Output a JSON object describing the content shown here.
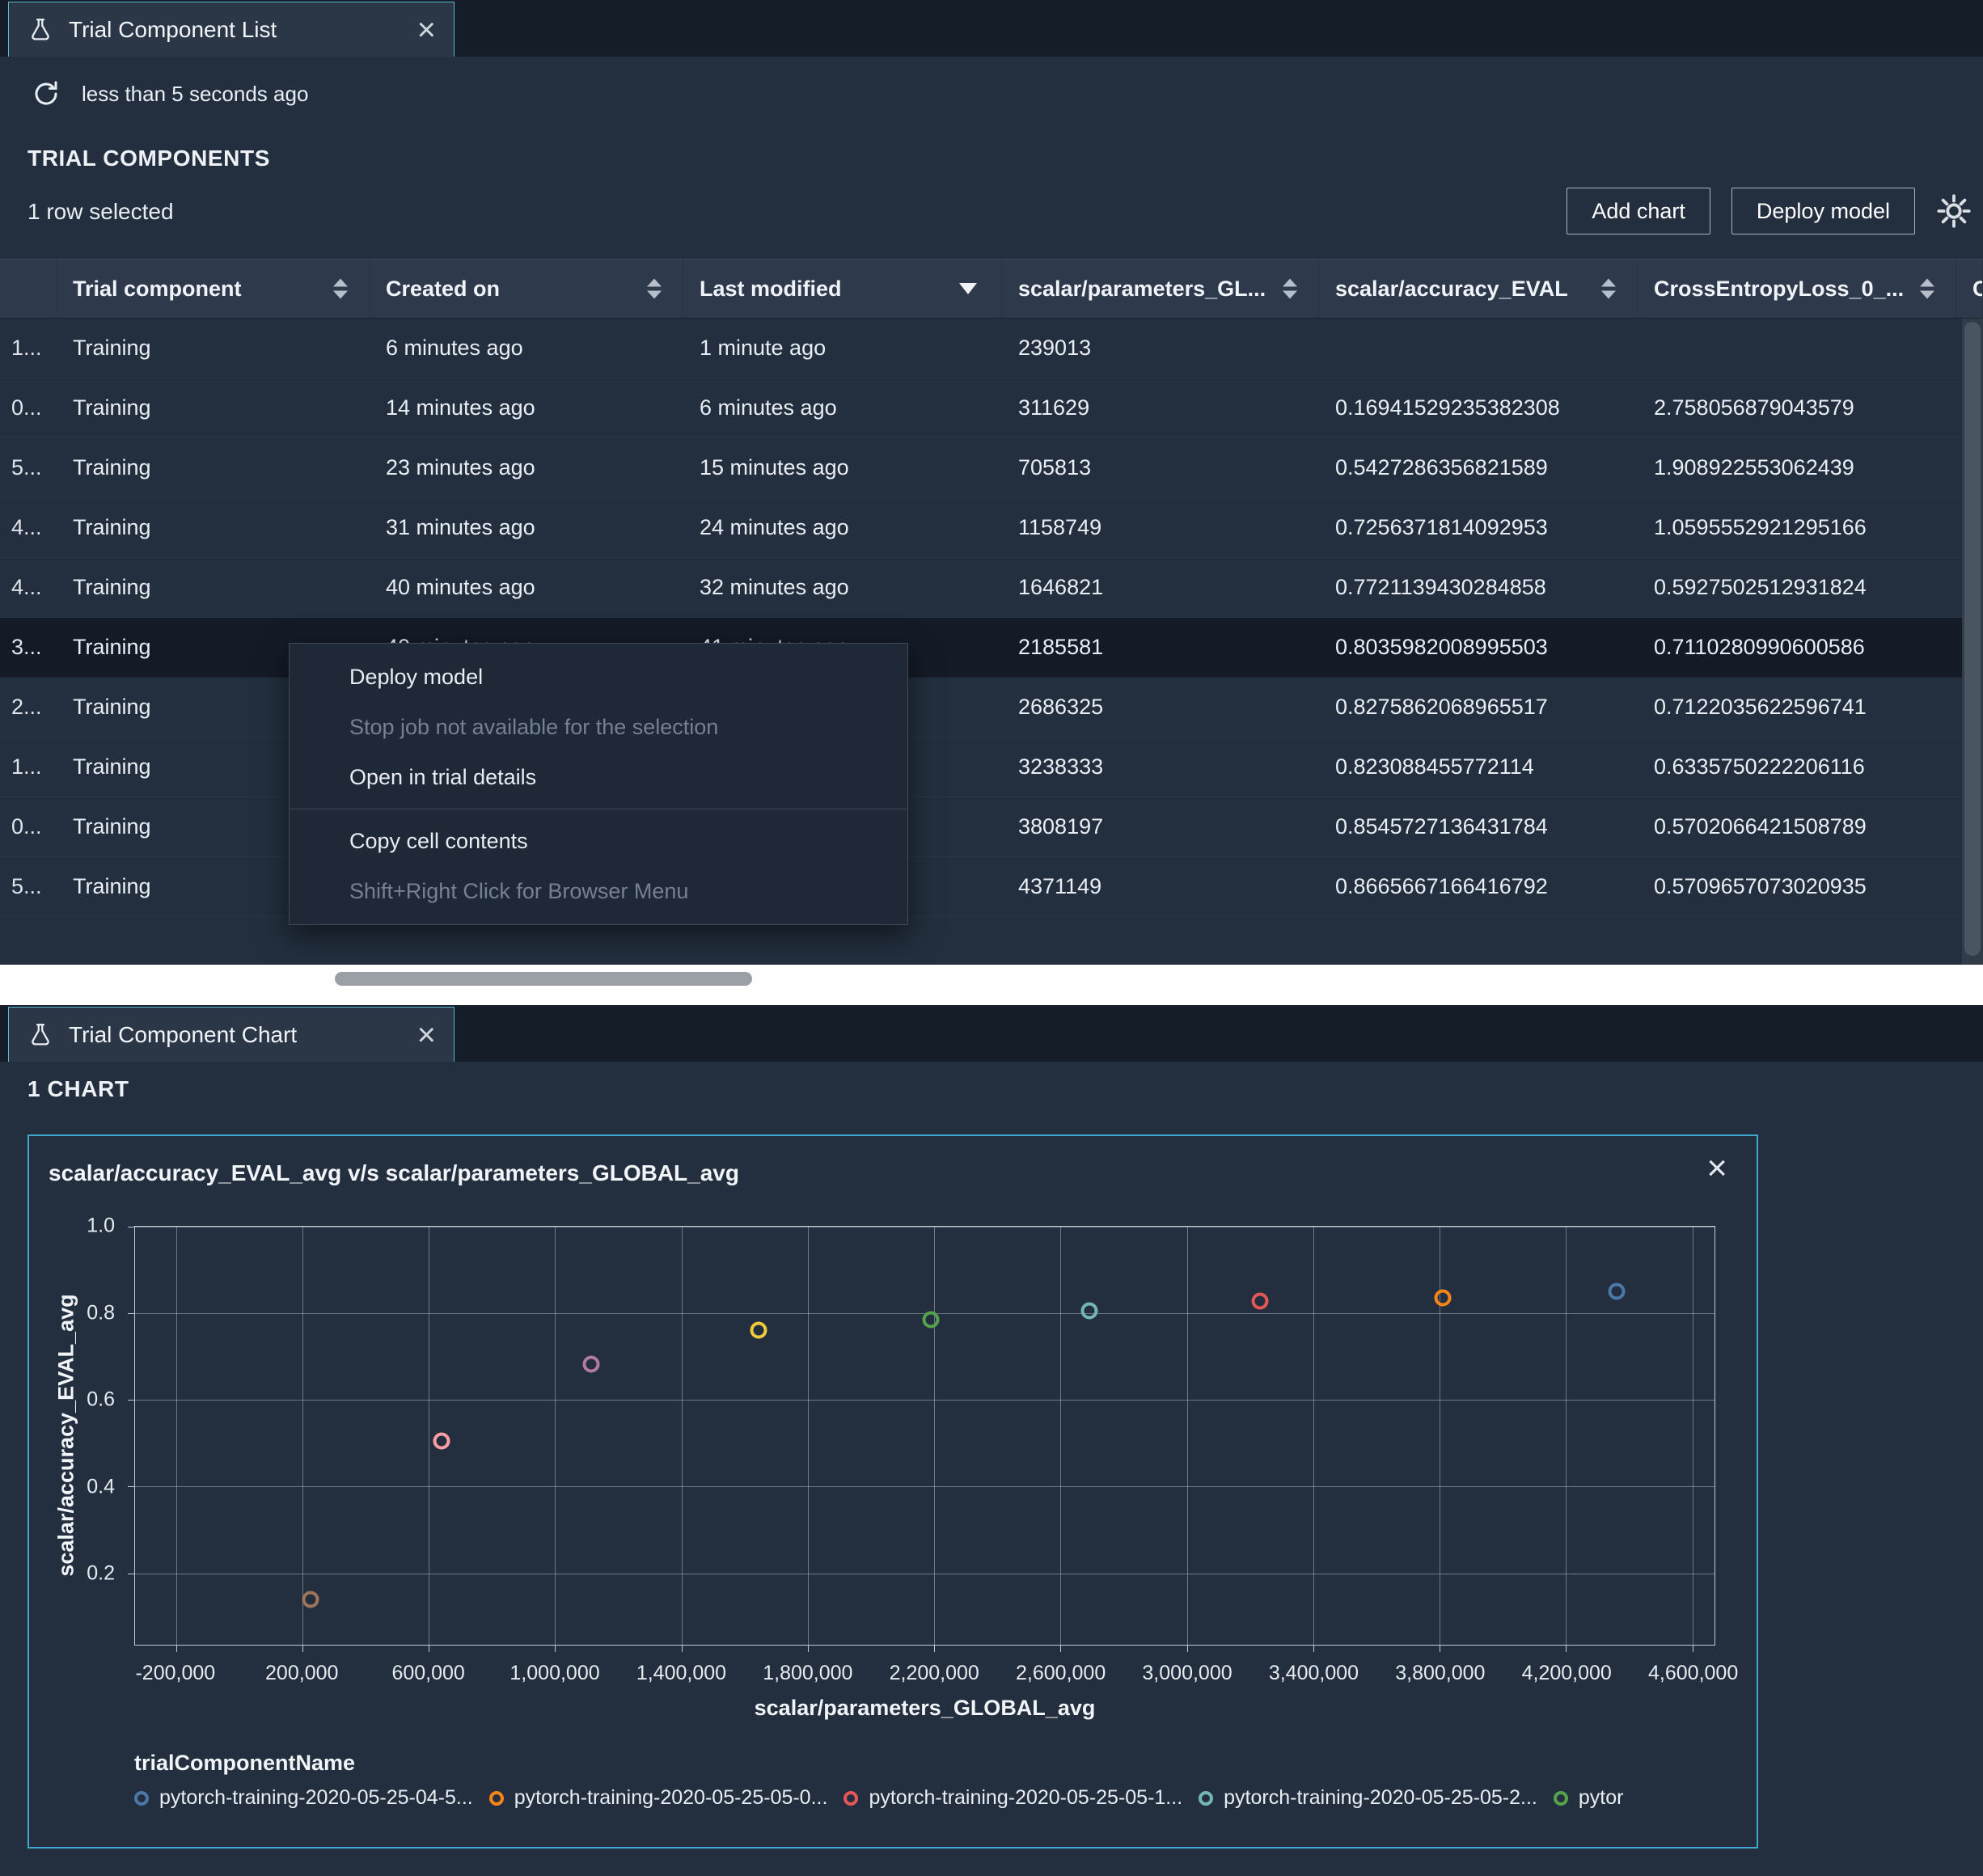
{
  "colors": {
    "panel_bg": "#232f3e",
    "tab_accent": "#58b7d2",
    "chart_border": "#3fa9cf",
    "selected_row_bg": "#141b27"
  },
  "icons": {
    "close": "×",
    "flask": "beaker-flask",
    "refresh": "circular-arrow",
    "gear": "gear",
    "sort": "up-down-arrows",
    "sort_desc": "filled-down-arrow"
  },
  "list_panel": {
    "tab_title": "Trial Component List",
    "refreshed": "less than 5 seconds ago",
    "section_title": "TRIAL COMPONENTS",
    "selection_status": "1 row selected",
    "buttons": {
      "add_chart": "Add chart",
      "deploy_model": "Deploy model"
    },
    "table": {
      "columns": [
        {
          "key": "name",
          "label": "",
          "sort": "none"
        },
        {
          "key": "trial-component",
          "label": "Trial component",
          "sort": "both"
        },
        {
          "key": "created-on",
          "label": "Created on",
          "sort": "both"
        },
        {
          "key": "last-modified",
          "label": "Last modified",
          "sort": "desc"
        },
        {
          "key": "parameters",
          "label": "scalar/parameters_GL...",
          "sort": "both"
        },
        {
          "key": "accuracy",
          "label": "scalar/accuracy_EVAL",
          "sort": "both"
        },
        {
          "key": "loss",
          "label": "CrossEntropyLoss_0_...",
          "sort": "both"
        },
        {
          "key": "extra",
          "label": "C",
          "sort": "none"
        }
      ],
      "rows": [
        {
          "name_trunc": "1...",
          "component": "Training",
          "created": "6 minutes ago",
          "modified": "1 minute ago",
          "parameters": "239013",
          "accuracy": "",
          "loss": ""
        },
        {
          "name_trunc": "0...",
          "component": "Training",
          "created": "14 minutes ago",
          "modified": "6 minutes ago",
          "parameters": "311629",
          "accuracy": "0.16941529235382308",
          "loss": "2.758056879043579"
        },
        {
          "name_trunc": "5...",
          "component": "Training",
          "created": "23 minutes ago",
          "modified": "15 minutes ago",
          "parameters": "705813",
          "accuracy": "0.5427286356821589",
          "loss": "1.908922553062439"
        },
        {
          "name_trunc": "4...",
          "component": "Training",
          "created": "31 minutes ago",
          "modified": "24 minutes ago",
          "parameters": "1158749",
          "accuracy": "0.7256371814092953",
          "loss": "1.0595552921295166"
        },
        {
          "name_trunc": "4...",
          "component": "Training",
          "created": "40 minutes ago",
          "modified": "32 minutes ago",
          "parameters": "1646821",
          "accuracy": "0.7721139430284858",
          "loss": "0.5927502512931824"
        },
        {
          "name_trunc": "3...",
          "component": "Training",
          "created": "40 minutes ago",
          "modified": "41 minutes ago",
          "parameters": "2185581",
          "accuracy": "0.8035982008995503",
          "loss": "0.7110280990600586",
          "selected": true
        },
        {
          "name_trunc": "2...",
          "component": "Training",
          "created": "",
          "modified": "",
          "parameters": "2686325",
          "accuracy": "0.8275862068965517",
          "loss": "0.7122035622596741"
        },
        {
          "name_trunc": "1...",
          "component": "Training",
          "created": "",
          "modified": "",
          "parameters": "3238333",
          "accuracy": "0.823088455772114",
          "loss": "0.6335750222206116"
        },
        {
          "name_trunc": "0...",
          "component": "Training",
          "created": "",
          "modified": "",
          "parameters": "3808197",
          "accuracy": "0.8545727136431784",
          "loss": "0.5702066421508789"
        },
        {
          "name_trunc": "5...",
          "component": "Training",
          "created": "",
          "modified": "",
          "parameters": "4371149",
          "accuracy": "0.8665667166416792",
          "loss": "0.5709657073020935"
        }
      ]
    },
    "context_menu": {
      "items": [
        {
          "label": "Deploy model",
          "enabled": true
        },
        {
          "label": "Stop job not available for the selection",
          "enabled": false
        },
        {
          "label": "Open in trial details",
          "enabled": true
        },
        {
          "divider": true
        },
        {
          "label": "Copy cell contents",
          "enabled": true
        },
        {
          "label": "Shift+Right Click for Browser Menu",
          "enabled": false
        }
      ]
    }
  },
  "chart_panel": {
    "tab_title": "Trial Component Chart",
    "section_title": "1 CHART"
  },
  "chart_data": {
    "type": "scatter",
    "title": "scalar/accuracy_EVAL_avg v/s scalar/parameters_GLOBAL_avg",
    "xlabel": "scalar/parameters_GLOBAL_avg",
    "ylabel": "scalar/accuracy_EVAL_avg",
    "legend_title": "trialComponentName",
    "legend_position": "bottom",
    "grid": true,
    "xlim": [
      -330000,
      4670000
    ],
    "ylim": [
      0.035,
      1.0
    ],
    "xticks": [
      -200000,
      200000,
      600000,
      1000000,
      1400000,
      1800000,
      2200000,
      2600000,
      3000000,
      3400000,
      3800000,
      4200000,
      4600000
    ],
    "xtick_labels": [
      "-200,000",
      "200,000",
      "600,000",
      "1,000,000",
      "1,400,000",
      "1,800,000",
      "2,200,000",
      "2,600,000",
      "3,000,000",
      "3,400,000",
      "3,800,000",
      "4,200,000",
      "4,600,000"
    ],
    "yticks": [
      0.2,
      0.4,
      0.6,
      0.8,
      1.0
    ],
    "ytick_labels": [
      "0.2",
      "0.4",
      "0.6",
      "0.8",
      "1.0"
    ],
    "series": [
      {
        "name": "pytorch-training-2020-05-25-04-5...",
        "color": "#4c78a8",
        "in_legend": true,
        "points": [
          [
            4360000,
            0.85
          ]
        ]
      },
      {
        "name": "pytorch-training-2020-05-25-05-0...",
        "color": "#f58518",
        "in_legend": true,
        "points": [
          [
            3810000,
            0.836
          ]
        ]
      },
      {
        "name": "pytorch-training-2020-05-25-05-1...",
        "color": "#e45756",
        "in_legend": true,
        "points": [
          [
            3230000,
            0.829
          ]
        ]
      },
      {
        "name": "pytorch-training-2020-05-25-05-2...",
        "color": "#72b7b2",
        "in_legend": true,
        "points": [
          [
            2690000,
            0.806
          ]
        ]
      },
      {
        "name": "pytor",
        "color": "#54a24b",
        "in_legend": true,
        "points": [
          [
            2190000,
            0.786
          ]
        ]
      },
      {
        "name": "",
        "color": "#eeca3b",
        "in_legend": false,
        "points": [
          [
            1645000,
            0.762
          ]
        ]
      },
      {
        "name": "",
        "color": "#b279a2",
        "in_legend": false,
        "points": [
          [
            1115000,
            0.683
          ]
        ]
      },
      {
        "name": "",
        "color": "#ff9da6",
        "in_legend": false,
        "points": [
          [
            640000,
            0.505
          ]
        ]
      },
      {
        "name": "",
        "color": "#9d755d",
        "in_legend": false,
        "points": [
          [
            225000,
            0.14
          ]
        ]
      }
    ]
  }
}
